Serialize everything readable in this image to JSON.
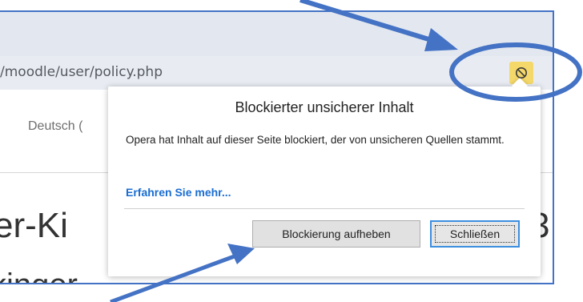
{
  "browser": {
    "url": "/moodle/user/policy.php",
    "block_icon": "blocked-content-icon"
  },
  "page": {
    "language_selector": "Deutsch (",
    "heading_line1_left": "er-Ki",
    "heading_line1_right": "3",
    "heading_line2": "kinger"
  },
  "popup": {
    "title": "Blockierter unsicherer Inhalt",
    "message": "Opera hat Inhalt auf dieser Seite blockiert, der von unsicheren Quellen stammt.",
    "learn_more": "Erfahren Sie mehr...",
    "unblock_label": "Blockierung aufheben",
    "close_label": "Schließen"
  },
  "annotations": {
    "arrow_color": "#4472c4",
    "ellipse_color": "#4472c4"
  }
}
